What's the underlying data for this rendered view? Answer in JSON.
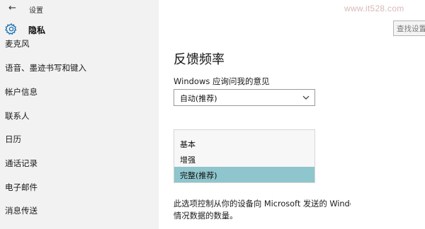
{
  "window": {
    "back_glyph": "←",
    "title": "设置",
    "watermark": "www.it528.com"
  },
  "header": {
    "icon": "gear-icon",
    "title": "隐私"
  },
  "search": {
    "placeholder": "查找设置"
  },
  "sidebar": {
    "items": [
      {
        "label": "麦克风"
      },
      {
        "label": "语音、墨迹书写和键入"
      },
      {
        "label": "帐户信息"
      },
      {
        "label": "联系人"
      },
      {
        "label": "日历"
      },
      {
        "label": "通话记录"
      },
      {
        "label": "电子邮件"
      },
      {
        "label": "消息传送"
      }
    ]
  },
  "main": {
    "section_title": "反馈频率",
    "question": "Windows 应询问我的意见",
    "dropdown_value": "自动(推荐)",
    "popup_options": [
      {
        "label": "基本"
      },
      {
        "label": "增强"
      },
      {
        "label": "完整(推荐)",
        "selected": true
      }
    ],
    "description_line1": "此选项控制从你的设备向 Microsoft 发送的 Windows",
    "description_line2": "情况数据的数量。"
  },
  "colors": {
    "sidebar_bg": "#f2f2f2",
    "selected_option_bg": "#8fc5cc"
  }
}
